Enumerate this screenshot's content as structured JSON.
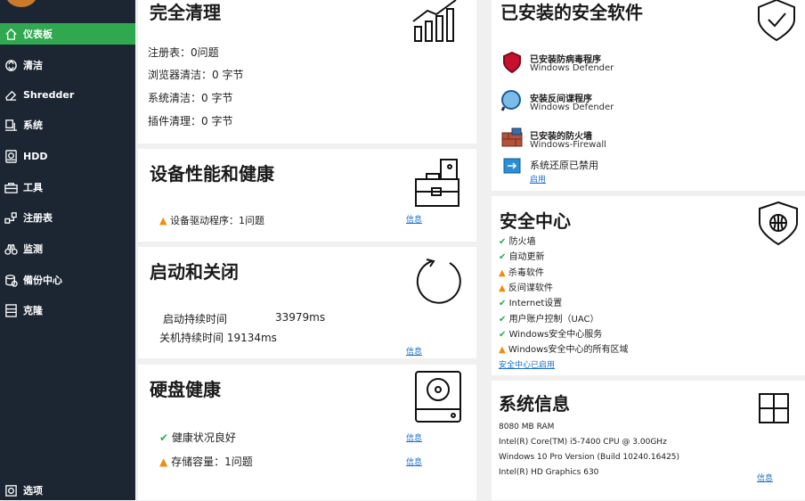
{
  "sidebar": {
    "items": [
      {
        "label": "仪表板",
        "icon": "home-icon"
      },
      {
        "label": "清洁",
        "icon": "recycle-icon"
      },
      {
        "label": "Shredder",
        "icon": "eraser-icon"
      },
      {
        "label": "系统",
        "icon": "computer-icon"
      },
      {
        "label": "HDD",
        "icon": "hdd-icon"
      },
      {
        "label": "工具",
        "icon": "toolbox-icon"
      },
      {
        "label": "注册表",
        "icon": "registry-icon"
      },
      {
        "label": "监测",
        "icon": "binoculars-icon"
      },
      {
        "label": "備份中心",
        "icon": "backup-icon"
      },
      {
        "label": "克隆",
        "icon": "clone-icon"
      }
    ],
    "options_label": "选项"
  },
  "clean": {
    "title": "完全清理",
    "lines": [
      "注册表：0问题",
      "浏览器清洁：0 字节",
      "系统清洁：0 字节",
      "插件清理：0 字节"
    ]
  },
  "performance": {
    "title": "设备性能和健康",
    "driver_line": "设备驱动程序：1问题",
    "link": "信息"
  },
  "startup": {
    "title": "启动和关闭",
    "boot_label": "启动持续时间",
    "boot_value": "33979ms",
    "shutdown_line": "关机持续时间 19134ms",
    "link": "信息"
  },
  "disk": {
    "title": "硬盘健康",
    "health_line": "健康状况良好",
    "storage_line": "存储容量：1问题",
    "link1": "信息",
    "link2": "信息"
  },
  "security_software": {
    "title": "已安装的安全软件",
    "items": [
      {
        "name": "已安装防病毒程序",
        "sub": "Windows Defender"
      },
      {
        "name": "安装反间谍程序",
        "sub": "Windows Defender"
      },
      {
        "name": "已安装的防火墙",
        "sub": "Windows-Firewall"
      }
    ],
    "restore_line": "系统还原已禁用",
    "restore_link": "启用"
  },
  "security_center": {
    "title": "安全中心",
    "items": [
      {
        "text": "防火墙",
        "status": "ok"
      },
      {
        "text": "自动更新",
        "status": "ok"
      },
      {
        "text": "杀毒软件",
        "status": "warn"
      },
      {
        "text": "反间谍软件",
        "status": "warn"
      },
      {
        "text": "Internet设置",
        "status": "ok"
      },
      {
        "text": "用户账户控制（UAC）",
        "status": "ok"
      },
      {
        "text": "Windows安全中心服务",
        "status": "ok"
      },
      {
        "text": "Windows安全中心的所有区域",
        "status": "warn"
      }
    ],
    "link": "安全中心已启用"
  },
  "system_info": {
    "title": "系统信息",
    "lines": [
      "8080 MB RAM",
      "Intel(R) Core(TM) i5-7400 CPU @ 3.00GHz",
      "Windows 10 Pro Version  (Build 10240.16425)",
      "Intel(R) HD Graphics 630"
    ],
    "link": "信息"
  },
  "colors": {
    "sidebar": "#1c2632",
    "accent": "#2fa84f",
    "warning": "#f28b0b",
    "link": "#1a6fd0"
  }
}
